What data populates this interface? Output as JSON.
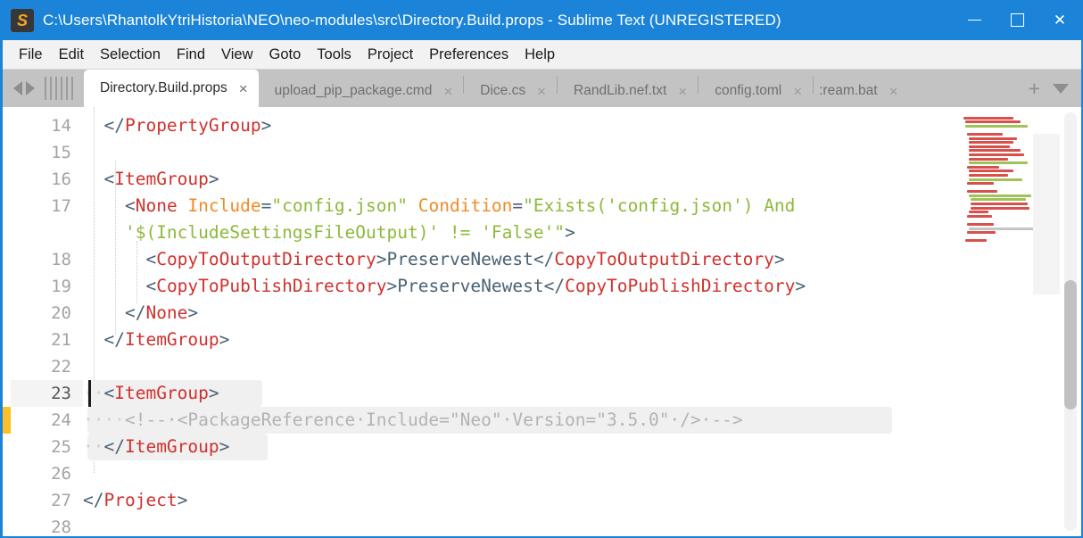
{
  "window": {
    "title": "C:\\Users\\RhantolkYtriHistoria\\NEO\\neo-modules\\src\\Directory.Build.props - Sublime Text (UNREGISTERED)",
    "logo_letter": "S",
    "accent_color": "#1b84d8",
    "controls": {
      "minimize": "–",
      "maximize": "□",
      "close": "×"
    }
  },
  "menubar": {
    "items": [
      "File",
      "Edit",
      "Selection",
      "Find",
      "View",
      "Goto",
      "Tools",
      "Project",
      "Preferences",
      "Help"
    ]
  },
  "tabbar": {
    "nav_prev": "◀",
    "nav_next": "▶",
    "new_tab_label": "+",
    "tab_menu_label": "▼",
    "close_glyph": "×",
    "tabs": [
      {
        "label": "Directory.Build.props",
        "active": true
      },
      {
        "label": "upload_pip_package.cmd",
        "active": false
      },
      {
        "label": "Dice.cs",
        "active": false
      },
      {
        "label": "RandLib.nef.txt",
        "active": false
      },
      {
        "label": "config.toml",
        "active": false
      },
      {
        "label": ":ream.bat",
        "active": false,
        "clipped": true
      }
    ]
  },
  "editor": {
    "file_syntax": "XML",
    "first_visible_line": 14,
    "cursor_line": 23,
    "selection_lines": [
      23,
      24,
      25
    ],
    "modified_marker_line": 24,
    "line_numbers": [
      "14",
      "15",
      "16",
      "17",
      "",
      "18",
      "19",
      "20",
      "21",
      "22",
      "23",
      "24",
      "25",
      "26",
      "27",
      "28"
    ],
    "lines": [
      {
        "num": "14",
        "tokens": [
          {
            "t": "  ",
            "c": "t-pun"
          },
          {
            "t": "</",
            "c": "t-pun"
          },
          {
            "t": "PropertyGroup",
            "c": "t-tag"
          },
          {
            "t": ">",
            "c": "t-pun"
          }
        ]
      },
      {
        "num": "15",
        "tokens": []
      },
      {
        "num": "16",
        "tokens": [
          {
            "t": "  ",
            "c": "t-pun"
          },
          {
            "t": "<",
            "c": "t-pun"
          },
          {
            "t": "ItemGroup",
            "c": "t-tag"
          },
          {
            "t": ">",
            "c": "t-pun"
          }
        ]
      },
      {
        "num": "17",
        "tokens": [
          {
            "t": "    ",
            "c": "t-pun"
          },
          {
            "t": "<",
            "c": "t-pun"
          },
          {
            "t": "None",
            "c": "t-tag"
          },
          {
            "t": " ",
            "c": "t-pun"
          },
          {
            "t": "Include",
            "c": "t-attr"
          },
          {
            "t": "=",
            "c": "t-pun"
          },
          {
            "t": "\"config.json\"",
            "c": "t-str"
          },
          {
            "t": " ",
            "c": "t-pun"
          },
          {
            "t": "Condition",
            "c": "t-attr"
          },
          {
            "t": "=",
            "c": "t-pun"
          },
          {
            "t": "\"Exists('config.json') And",
            "c": "t-str"
          }
        ]
      },
      {
        "num": "",
        "tokens": [
          {
            "t": "    ",
            "c": "t-pun"
          },
          {
            "t": "'$(IncludeSettingsFileOutput)' != 'False'\"",
            "c": "t-str"
          },
          {
            "t": ">",
            "c": "t-pun"
          }
        ]
      },
      {
        "num": "18",
        "tokens": [
          {
            "t": "      ",
            "c": "t-pun"
          },
          {
            "t": "<",
            "c": "t-pun"
          },
          {
            "t": "CopyToOutputDirectory",
            "c": "t-tag"
          },
          {
            "t": ">",
            "c": "t-pun"
          },
          {
            "t": "PreserveNewest",
            "c": "t-txt"
          },
          {
            "t": "</",
            "c": "t-pun"
          },
          {
            "t": "CopyToOutputDirectory",
            "c": "t-tag"
          },
          {
            "t": ">",
            "c": "t-pun"
          }
        ]
      },
      {
        "num": "19",
        "tokens": [
          {
            "t": "      ",
            "c": "t-pun"
          },
          {
            "t": "<",
            "c": "t-pun"
          },
          {
            "t": "CopyToPublishDirectory",
            "c": "t-tag"
          },
          {
            "t": ">",
            "c": "t-pun"
          },
          {
            "t": "PreserveNewest",
            "c": "t-txt"
          },
          {
            "t": "</",
            "c": "t-pun"
          },
          {
            "t": "CopyToPublishDirectory",
            "c": "t-tag"
          },
          {
            "t": ">",
            "c": "t-pun"
          }
        ]
      },
      {
        "num": "20",
        "tokens": [
          {
            "t": "    ",
            "c": "t-pun"
          },
          {
            "t": "</",
            "c": "t-pun"
          },
          {
            "t": "None",
            "c": "t-tag"
          },
          {
            "t": ">",
            "c": "t-pun"
          }
        ]
      },
      {
        "num": "21",
        "tokens": [
          {
            "t": "  ",
            "c": "t-pun"
          },
          {
            "t": "</",
            "c": "t-pun"
          },
          {
            "t": "ItemGroup",
            "c": "t-tag"
          },
          {
            "t": ">",
            "c": "t-pun"
          }
        ]
      },
      {
        "num": "22",
        "tokens": []
      },
      {
        "num": "23",
        "tokens": [
          {
            "t": "··",
            "c": "ws"
          },
          {
            "t": "<",
            "c": "t-pun"
          },
          {
            "t": "ItemGroup",
            "c": "t-tag"
          },
          {
            "t": ">",
            "c": "t-pun"
          }
        ]
      },
      {
        "num": "24",
        "tokens": [
          {
            "t": "····",
            "c": "ws"
          },
          {
            "t": "<!--·<PackageReference·Include=\"Neo\"·Version=\"3.5.0\"·/>·-->",
            "c": "t-com"
          }
        ]
      },
      {
        "num": "25",
        "tokens": [
          {
            "t": "··",
            "c": "ws"
          },
          {
            "t": "</",
            "c": "t-pun"
          },
          {
            "t": "ItemGroup",
            "c": "t-tag"
          },
          {
            "t": ">",
            "c": "t-pun"
          }
        ]
      },
      {
        "num": "26",
        "tokens": []
      },
      {
        "num": "27",
        "tokens": [
          {
            "t": "</",
            "c": "t-pun"
          },
          {
            "t": "Project",
            "c": "t-tag"
          },
          {
            "t": ">",
            "c": "t-pun"
          }
        ]
      },
      {
        "num": "28",
        "tokens": []
      }
    ]
  },
  "scrollbar": {
    "thumb_top_pct": 40,
    "thumb_height_pct": 31
  },
  "minimap": {
    "visible": true
  }
}
